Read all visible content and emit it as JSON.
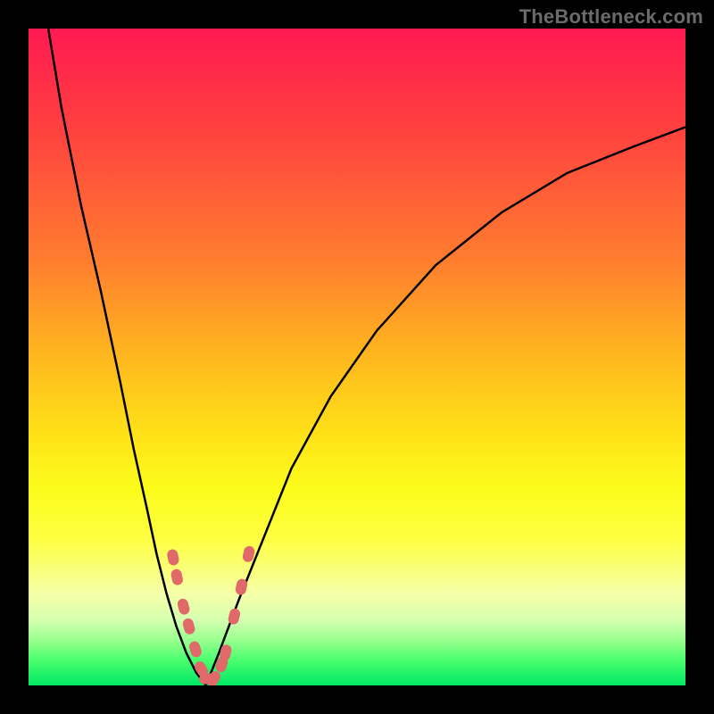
{
  "watermark": "TheBottleneck.com",
  "colors": {
    "background": "#000000",
    "gradient_top": "#ff1a52",
    "gradient_bottom": "#00e865",
    "curve": "#000000",
    "markers": "#e06a6a"
  },
  "chart_data": {
    "type": "line",
    "title": "",
    "xlabel": "",
    "ylabel": "",
    "xlim": [
      0,
      100
    ],
    "ylim": [
      0,
      100
    ],
    "series": [
      {
        "name": "left-branch",
        "x": [
          3,
          5,
          8,
          11,
          14,
          16,
          18,
          19.5,
          21,
          22.5,
          24,
          25.5,
          27
        ],
        "y": [
          100,
          88,
          73,
          60,
          46,
          36,
          27,
          20,
          14,
          9,
          5,
          2,
          0
        ]
      },
      {
        "name": "right-branch",
        "x": [
          27,
          29,
          32,
          36,
          40,
          46,
          53,
          62,
          72,
          82,
          92,
          100
        ],
        "y": [
          0,
          5,
          13,
          23,
          33,
          44,
          54,
          64,
          72,
          78,
          82,
          85
        ]
      }
    ],
    "markers": {
      "name": "data-points",
      "x": [
        22.0,
        22.6,
        23.6,
        24.4,
        25.4,
        26.3,
        27.2,
        28.2,
        29.4,
        30.0,
        31.3,
        32.4,
        33.5
      ],
      "y": [
        19.5,
        16.5,
        12.0,
        9.0,
        5.5,
        2.5,
        1.0,
        1.0,
        3.2,
        5.0,
        10.5,
        15.0,
        20.0
      ]
    }
  }
}
